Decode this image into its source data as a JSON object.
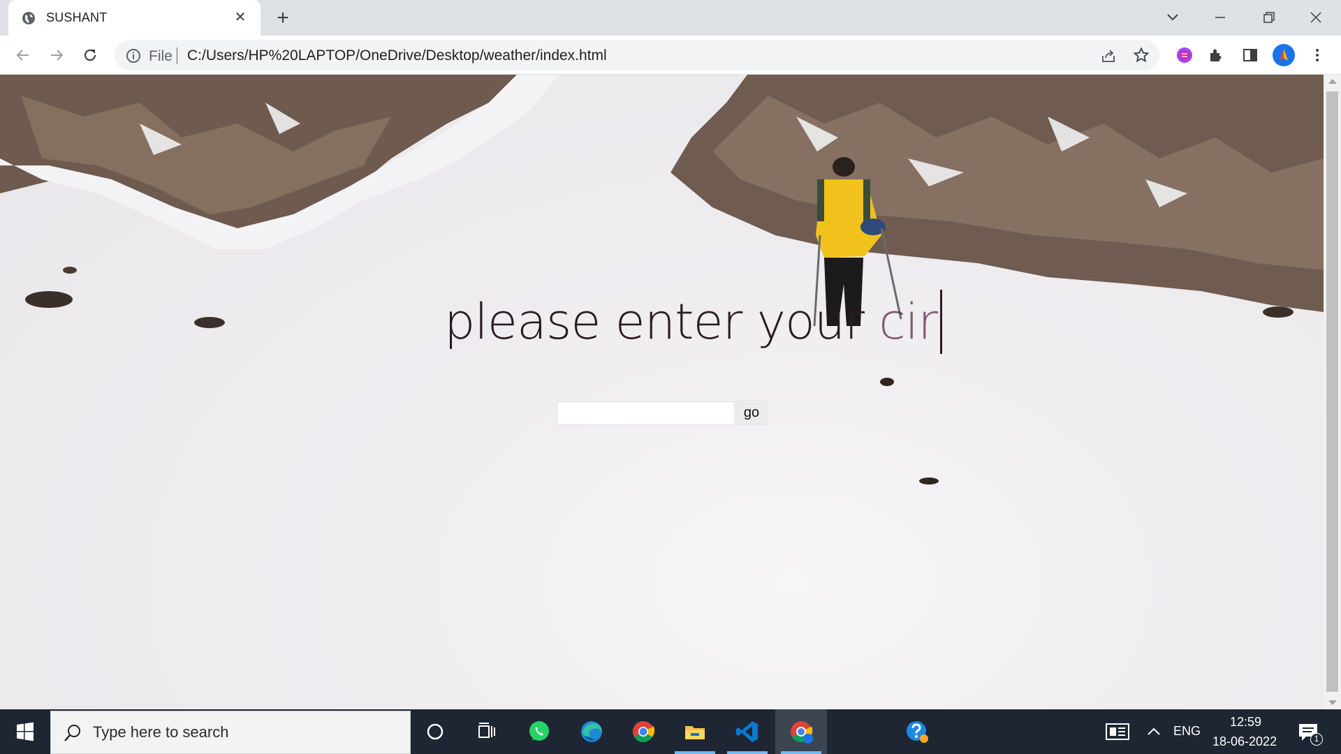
{
  "browser": {
    "tab": {
      "title": "SUSHANT"
    },
    "omnibox": {
      "scheme_label": "File",
      "url": "C:/Users/HP%20LAPTOP/OneDrive/Desktop/weather/index.html"
    }
  },
  "page": {
    "headline_main": "please enter your ",
    "headline_typing": "cir",
    "search_value": "",
    "go_label": "go"
  },
  "taskbar": {
    "search_placeholder": "Type here to search",
    "language": "ENG",
    "time": "12:59",
    "date": "18-06-2022",
    "notification_count": "1"
  },
  "colors": {
    "accent_blue": "#1a73e8",
    "taskbar": "#1d2632",
    "headline": "#2b1b22"
  }
}
